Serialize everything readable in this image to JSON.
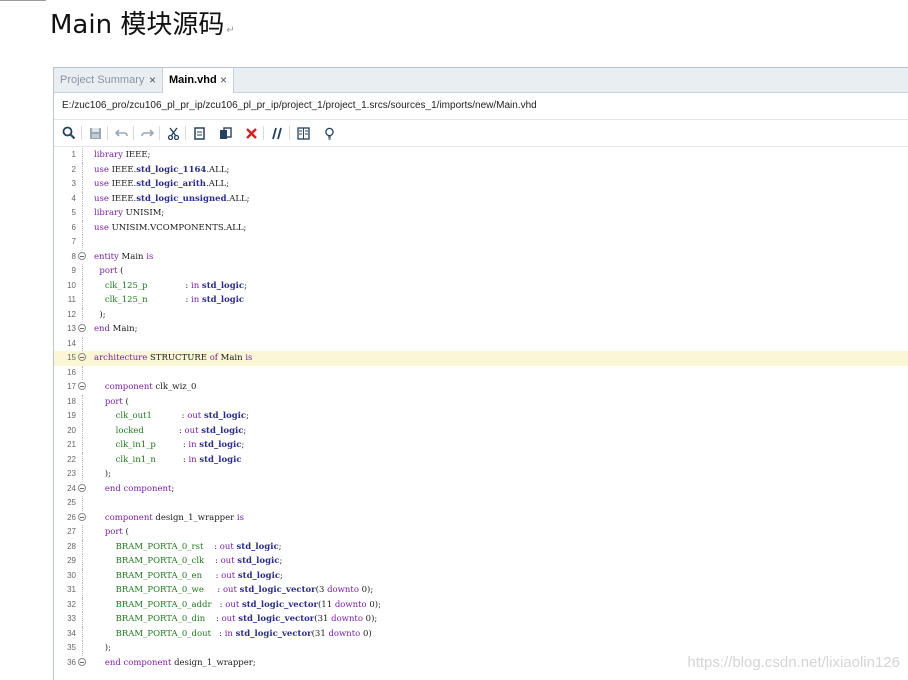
{
  "document": {
    "heading": "Main 模块源码",
    "return_mark": "↵"
  },
  "ide": {
    "tabs": [
      {
        "label": "Project Summary",
        "close": "×",
        "active": false
      },
      {
        "label": "Main.vhd",
        "close": "×",
        "active": true
      }
    ],
    "file_path": "E:/zuc106_pro/zcu106_pl_pr_ip/zcu106_pl_pr_ip/project_1/project_1.srcs/sources_1/imports/new/Main.vhd",
    "toolbar_icons": [
      "search-icon",
      "save-icon",
      "undo-icon",
      "redo-icon",
      "cut-icon",
      "copy-icon",
      "paste-icon",
      "delete-icon",
      "comment-icon",
      "columns-icon",
      "lightbulb-icon"
    ],
    "highlight_line": 15,
    "code_lines": [
      {
        "n": "1",
        "text": "library IEEE;"
      },
      {
        "n": "2",
        "text": "use IEEE.std_logic_1164.ALL;"
      },
      {
        "n": "3",
        "text": "use IEEE.std_logic_arith.ALL;"
      },
      {
        "n": "4",
        "text": "use IEEE.std_logic_unsigned.ALL;"
      },
      {
        "n": "5",
        "text": "library UNISIM;"
      },
      {
        "n": "6",
        "text": "use UNISIM.VCOMPONENTS.ALL;"
      },
      {
        "n": "7",
        "text": ""
      },
      {
        "n": "8",
        "text": "entity Main is"
      },
      {
        "n": "9",
        "text": "  port ("
      },
      {
        "n": "10",
        "text": "    clk_125_p              : in std_logic;"
      },
      {
        "n": "11",
        "text": "    clk_125_n              : in std_logic"
      },
      {
        "n": "12",
        "text": "  );"
      },
      {
        "n": "13",
        "text": "end Main;"
      },
      {
        "n": "14",
        "text": ""
      },
      {
        "n": "15",
        "text": "architecture STRUCTURE of Main is"
      },
      {
        "n": "16",
        "text": ""
      },
      {
        "n": "17",
        "text": "    component clk_wiz_0"
      },
      {
        "n": "18",
        "text": "    port ("
      },
      {
        "n": "19",
        "text": "        clk_out1           : out std_logic;"
      },
      {
        "n": "20",
        "text": "        locked             : out std_logic;"
      },
      {
        "n": "21",
        "text": "        clk_in1_p          : in std_logic;"
      },
      {
        "n": "22",
        "text": "        clk_in1_n          : in std_logic"
      },
      {
        "n": "23",
        "text": "    );"
      },
      {
        "n": "24",
        "text": "    end component;"
      },
      {
        "n": "25",
        "text": ""
      },
      {
        "n": "26",
        "text": "    component design_1_wrapper is"
      },
      {
        "n": "27",
        "text": "    port ("
      },
      {
        "n": "28",
        "text": "        BRAM_PORTA_0_rst    : out std_logic;"
      },
      {
        "n": "29",
        "text": "        BRAM_PORTA_0_clk    : out std_logic;"
      },
      {
        "n": "30",
        "text": "        BRAM_PORTA_0_en     : out std_logic;"
      },
      {
        "n": "31",
        "text": "        BRAM_PORTA_0_we     : out std_logic_vector(3 downto 0);"
      },
      {
        "n": "32",
        "text": "        BRAM_PORTA_0_addr   : out std_logic_vector(11 downto 0);"
      },
      {
        "n": "33",
        "text": "        BRAM_PORTA_0_din    : out std_logic_vector(31 downto 0);"
      },
      {
        "n": "34",
        "text": "        BRAM_PORTA_0_dout   : in std_logic_vector(31 downto 0)"
      },
      {
        "n": "35",
        "text": "    );"
      },
      {
        "n": "36",
        "text": "    end component design_1_wrapper;"
      }
    ]
  },
  "watermark": "https://blog.csdn.net/lixiaolin126",
  "colors": {
    "keyword": "#7a1fa2",
    "type": "#2c2c8a",
    "signal": "#1f7a1f",
    "highlight": "#fbf7d6",
    "tab_bar": "#e9eef3"
  }
}
